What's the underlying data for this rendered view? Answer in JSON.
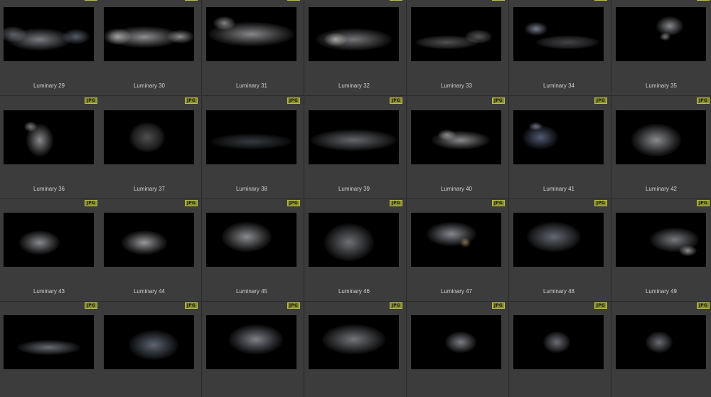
{
  "badge_text": "JPG",
  "thumbnails": [
    {
      "label": "Luminary 29"
    },
    {
      "label": "Luminary 30"
    },
    {
      "label": "Luminary 31"
    },
    {
      "label": "Luminary 32"
    },
    {
      "label": "Luminary 33"
    },
    {
      "label": "Luminary 34"
    },
    {
      "label": "Luminary 35"
    },
    {
      "label": "Luminary 36"
    },
    {
      "label": "Luminary 37"
    },
    {
      "label": "Luminary 38"
    },
    {
      "label": "Luminary 39"
    },
    {
      "label": "Luminary 40"
    },
    {
      "label": "Luminary 41"
    },
    {
      "label": "Luminary 42"
    },
    {
      "label": "Luminary 43"
    },
    {
      "label": "Luminary 44"
    },
    {
      "label": "Luminary 45"
    },
    {
      "label": "Luminary 46"
    },
    {
      "label": "Luminary 47"
    },
    {
      "label": "Luminary 48"
    },
    {
      "label": "Luminary 49"
    },
    {
      "label": ""
    },
    {
      "label": ""
    },
    {
      "label": ""
    },
    {
      "label": ""
    },
    {
      "label": ""
    },
    {
      "label": ""
    },
    {
      "label": ""
    }
  ]
}
